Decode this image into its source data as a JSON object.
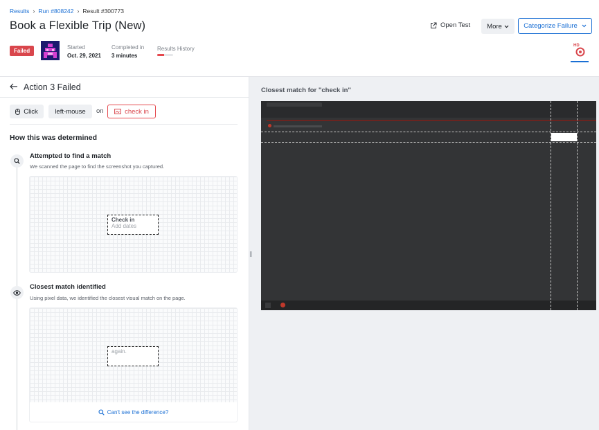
{
  "breadcrumb": {
    "results": "Results",
    "run": "Run #808242",
    "result": "Result #300773"
  },
  "header": {
    "title": "Book a Flexible Trip (New)",
    "status": "Failed",
    "started_label": "Started",
    "started_value": "Oct. 29, 2021",
    "completed_label": "Completed in",
    "completed_value": "3 minutes",
    "history_label": "Results History",
    "history_fraction": 0.45,
    "open_test_label": "Open Test",
    "more_label": "More",
    "categorize_label": "Categorize Failure",
    "browser_badge": "HD"
  },
  "action": {
    "title": "Action 3 Failed",
    "click_label": "Click",
    "mouse_label": "left-mouse",
    "on_word": "on",
    "target_label": "check in"
  },
  "determination": {
    "title": "How this was determined",
    "step1_title": "Attempted to find a match",
    "step1_desc": "We scanned the page to find the screenshot you captured.",
    "crop_line1": "Check in",
    "crop_line2": "Add dates",
    "step2_title": "Closest match identified",
    "step2_desc": "Using pixel data, we identified the closest visual match on the page.",
    "match_text": "again.",
    "diff_link": "Can't see the difference?"
  },
  "closest_match": {
    "title": "Closest match for \"check in\""
  },
  "colors": {
    "accent": "#1a6fd4",
    "failed": "#d9464c",
    "avatar": "#1c1a6e"
  },
  "icons": [
    "external-link-icon",
    "chevron-down-icon",
    "back-arrow-icon",
    "mouse-icon",
    "image-icon",
    "search-icon",
    "eye-icon",
    "chrome-icon"
  ]
}
